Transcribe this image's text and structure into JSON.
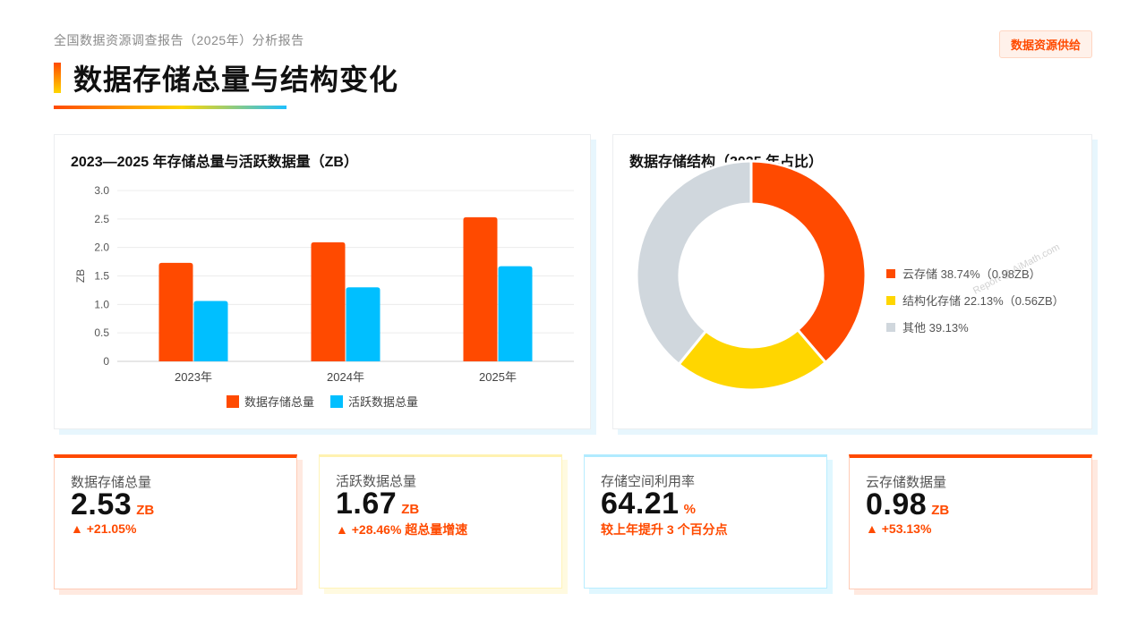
{
  "header": {
    "subtitle": "全国数据资源调查报告（2025年）分析报告",
    "title": "数据存储总量与结构变化",
    "badge": "数据资源供给"
  },
  "colors": {
    "orange": "#ff4a00",
    "cyan": "#00bfff",
    "yellow": "#ffd600",
    "gray": "#d0d7dd"
  },
  "chart_data": [
    {
      "type": "bar",
      "title": "2023—2025 年存储总量与活跃数据量（ZB）",
      "ylabel": "ZB",
      "xlabel": "",
      "categories": [
        "2023年",
        "2024年",
        "2025年"
      ],
      "ylim": [
        0,
        3.0
      ],
      "yticks": [
        "0",
        "0.5",
        "1.0",
        "1.5",
        "2.0",
        "2.5",
        "3.0"
      ],
      "grid": true,
      "legend_position": "bottom",
      "series": [
        {
          "name": "数据存储总量",
          "color": "#ff4a00",
          "values": [
            1.73,
            2.09,
            2.53
          ]
        },
        {
          "name": "活跃数据总量",
          "color": "#00bfff",
          "values": [
            1.06,
            1.3,
            1.67
          ]
        }
      ]
    },
    {
      "type": "pie",
      "title": "数据存储结构（2025 年占比）",
      "legend_position": "right",
      "slices": [
        {
          "name": "云存储",
          "value": 38.74,
          "color": "#ff4a00",
          "label": "云存储 38.74%（0.98ZB）"
        },
        {
          "name": "结构化存储",
          "value": 22.13,
          "color": "#ffd600",
          "label": "结构化存储 22.13%（0.56ZB）"
        },
        {
          "name": "其他",
          "value": 39.13,
          "color": "#d0d7dd",
          "label": "其他 39.13%"
        }
      ]
    }
  ],
  "watermark": "Report @ AiMath.com",
  "kpis": [
    {
      "label": "数据存储总量",
      "value": "2.53",
      "unit": "ZB",
      "change": "▲ +21.05%",
      "accent": "#ff4a00"
    },
    {
      "label": "活跃数据总量",
      "value": "1.67",
      "unit": "ZB",
      "change": "▲ +28.46% 超总量增速",
      "accent": "#ffd600"
    },
    {
      "label": "存储空间利用率",
      "value": "64.21",
      "unit": "%",
      "change": "较上年提升 3 个百分点",
      "accent": "#00bfff"
    },
    {
      "label": "云存储数据量",
      "value": "0.98",
      "unit": "ZB",
      "change": "▲ +53.13%",
      "accent": "#ff4a00"
    }
  ]
}
